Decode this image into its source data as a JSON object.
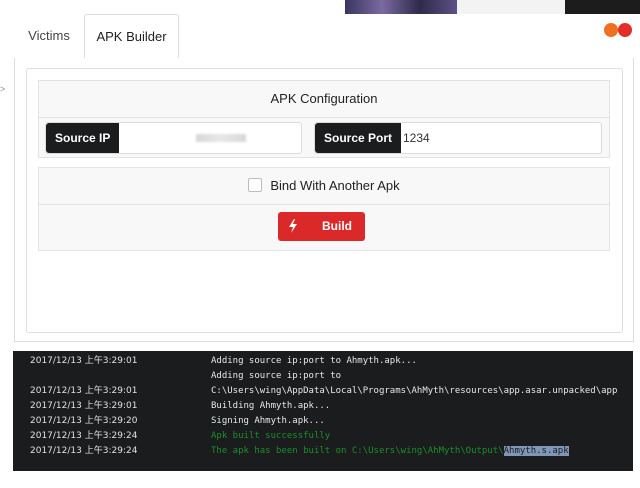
{
  "tabs": [
    {
      "label": "Victims",
      "active": false
    },
    {
      "label": "APK Builder",
      "active": true
    }
  ],
  "window_controls": {
    "colors": [
      "#f07020",
      "#e52d27"
    ]
  },
  "edge_mark": ">",
  "config": {
    "title": "APK Configuration",
    "source_ip": {
      "label": "Source IP",
      "value": ""
    },
    "source_port": {
      "label": "Source Port",
      "value": "1234"
    }
  },
  "bind": {
    "label": "Bind With Another Apk",
    "checked": false
  },
  "build": {
    "label": "Build",
    "icon": "lightning-bolt-icon",
    "color": "#db2828"
  },
  "console": {
    "logs": [
      {
        "time": "2017/12/13 上午3:29:01",
        "message": "Adding source ip:port to Ahmyth.apk...",
        "style": "normal"
      },
      {
        "time": "",
        "message": "Adding source ip:port to",
        "style": "normal"
      },
      {
        "time": "2017/12/13 上午3:29:01",
        "message": "C:\\Users\\wing\\AppData\\Local\\Programs\\AhMyth\\resources\\app.asar.unpacked\\app",
        "style": "normal"
      },
      {
        "time": "2017/12/13 上午3:29:01",
        "message": "Building Ahmyth.apk...",
        "style": "normal"
      },
      {
        "time": "2017/12/13 上午3:29:20",
        "message": "Signing Ahmyth.apk...",
        "style": "normal"
      },
      {
        "time": "2017/12/13 上午3:29:24",
        "message": "Apk built successfully",
        "style": "success"
      },
      {
        "time": "2017/12/13 上午3:29:24",
        "message": "The apk has been built on C:\\Users\\wing\\AhMyth\\Output\\",
        "highlight": "Ahmyth.s.apk",
        "style": "success"
      }
    ]
  }
}
